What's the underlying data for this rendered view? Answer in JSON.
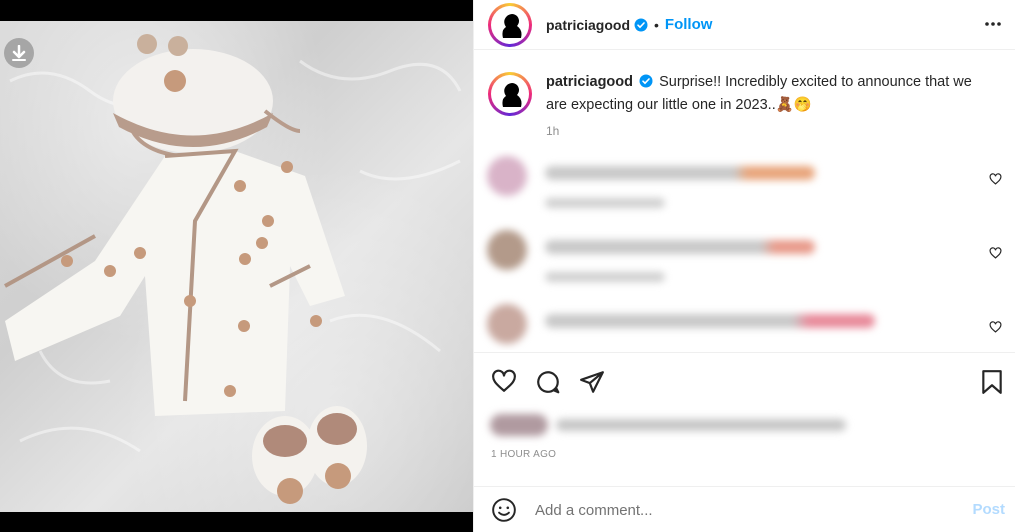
{
  "post": {
    "username": "patriciagood",
    "follow_label": "Follow",
    "dot": "•",
    "caption": "Surprise!! Incredibly excited to announce that we are expecting our little one in 2023..🧸🤭",
    "caption_age": "1h",
    "posted_ago": "1 HOUR AGO"
  },
  "comment_box": {
    "placeholder": "Add a comment...",
    "post_label": "Post"
  },
  "colors": {
    "accent": "#0095f6",
    "post_disabled": "#b3dbff",
    "muted": "#8e8e8e"
  },
  "icons": {
    "header_more": "more-options-icon",
    "verified": "verified-badge-icon",
    "like": "heart-icon",
    "comment": "comment-icon",
    "share": "share-icon",
    "save": "bookmark-icon",
    "emoji": "emoji-icon",
    "download": "download-icon"
  }
}
